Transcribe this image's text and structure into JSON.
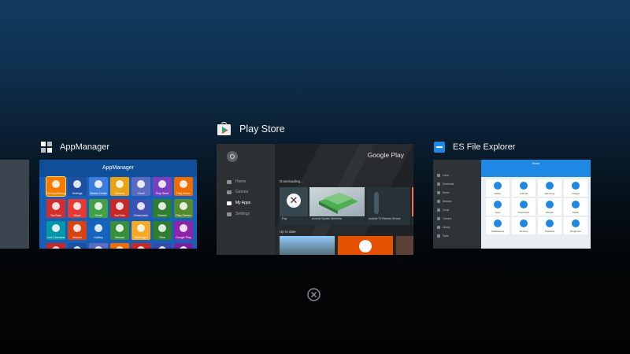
{
  "recents": {
    "focused_app": "Play Store",
    "cards": [
      {
        "title": "AppManager",
        "icon": "app-manager-icon",
        "header": "AppManager",
        "tiles": [
          {
            "label": "Old AppManager",
            "color": "#f57c00"
          },
          {
            "label": "Settings",
            "color": "#1e4fa0"
          },
          {
            "label": "Media Center",
            "color": "#3b7dd8"
          },
          {
            "label": "Chrome",
            "color": "#e8a317"
          },
          {
            "label": "Clock",
            "color": "#5c6bc0"
          },
          {
            "label": "Play Store",
            "color": "#7b3fbf"
          },
          {
            "label": "Play Music",
            "color": "#ef6c00"
          },
          {
            "label": "YouTube",
            "color": "#d32f2f"
          },
          {
            "label": "Maps",
            "color": "#e53935"
          },
          {
            "label": "Gmail",
            "color": "#43a047"
          },
          {
            "label": "YouTube",
            "color": "#c62828"
          },
          {
            "label": "Downloads",
            "color": "#3f51b5"
          },
          {
            "label": "Search",
            "color": "#2e7d32"
          },
          {
            "label": "Play Games",
            "color": "#558b2f"
          },
          {
            "label": "Live Channels",
            "color": "#0097a7"
          },
          {
            "label": "Movies",
            "color": "#d84315"
          },
          {
            "label": "Gallery",
            "color": "#1565c0"
          },
          {
            "label": "Wecast",
            "color": "#388e3c"
          },
          {
            "label": "AMAnager",
            "color": "#f9a825"
          },
          {
            "label": "Files",
            "color": "#2e7d32"
          },
          {
            "label": "Google Play",
            "color": "#8e24aa"
          },
          {
            "label": "",
            "color": "#c62828"
          },
          {
            "label": "",
            "color": "#1e4fa0"
          },
          {
            "label": "",
            "color": "#5c6bc0"
          },
          {
            "label": "",
            "color": "#ef6c00"
          },
          {
            "label": "",
            "color": "#c62828"
          },
          {
            "label": "",
            "color": "#3949ab"
          },
          {
            "label": "",
            "color": "#7b1fa2"
          }
        ]
      },
      {
        "title": "Play Store",
        "icon": "play-store-icon",
        "logo": "Google Play",
        "nav": [
          {
            "label": "Home",
            "icon": "home-icon",
            "active": false
          },
          {
            "label": "Games",
            "icon": "gamepad-icon",
            "active": false
          },
          {
            "label": "My Apps",
            "icon": "apps-icon",
            "active": true
          },
          {
            "label": "Settings",
            "icon": "gear-icon",
            "active": false
          }
        ],
        "downloading_label": "Downloading...",
        "tiles": [
          {
            "caption": "Play"
          },
          {
            "caption": "Android System WebView"
          },
          {
            "caption": "Android TV Remote Service"
          },
          {
            "caption": ""
          }
        ],
        "up_to_date_label": "Up to date"
      },
      {
        "title": "ES File Explorer",
        "icon": "es-file-explorer-icon",
        "header": "Home",
        "sidebar": [
          "Local",
          "Download",
          "Home",
          "Network",
          "Cloud",
          "Camera",
          "Library",
          "Tools"
        ],
        "items": [
          "Gallery",
          "Android",
          "Samsung",
          "Images",
          "Apps",
          "Downloads",
          "Movies",
          "Music",
          "Notifications",
          "Pictures",
          "Podcasts",
          "Ringtones"
        ]
      }
    ],
    "close_all": "close-all-icon"
  }
}
